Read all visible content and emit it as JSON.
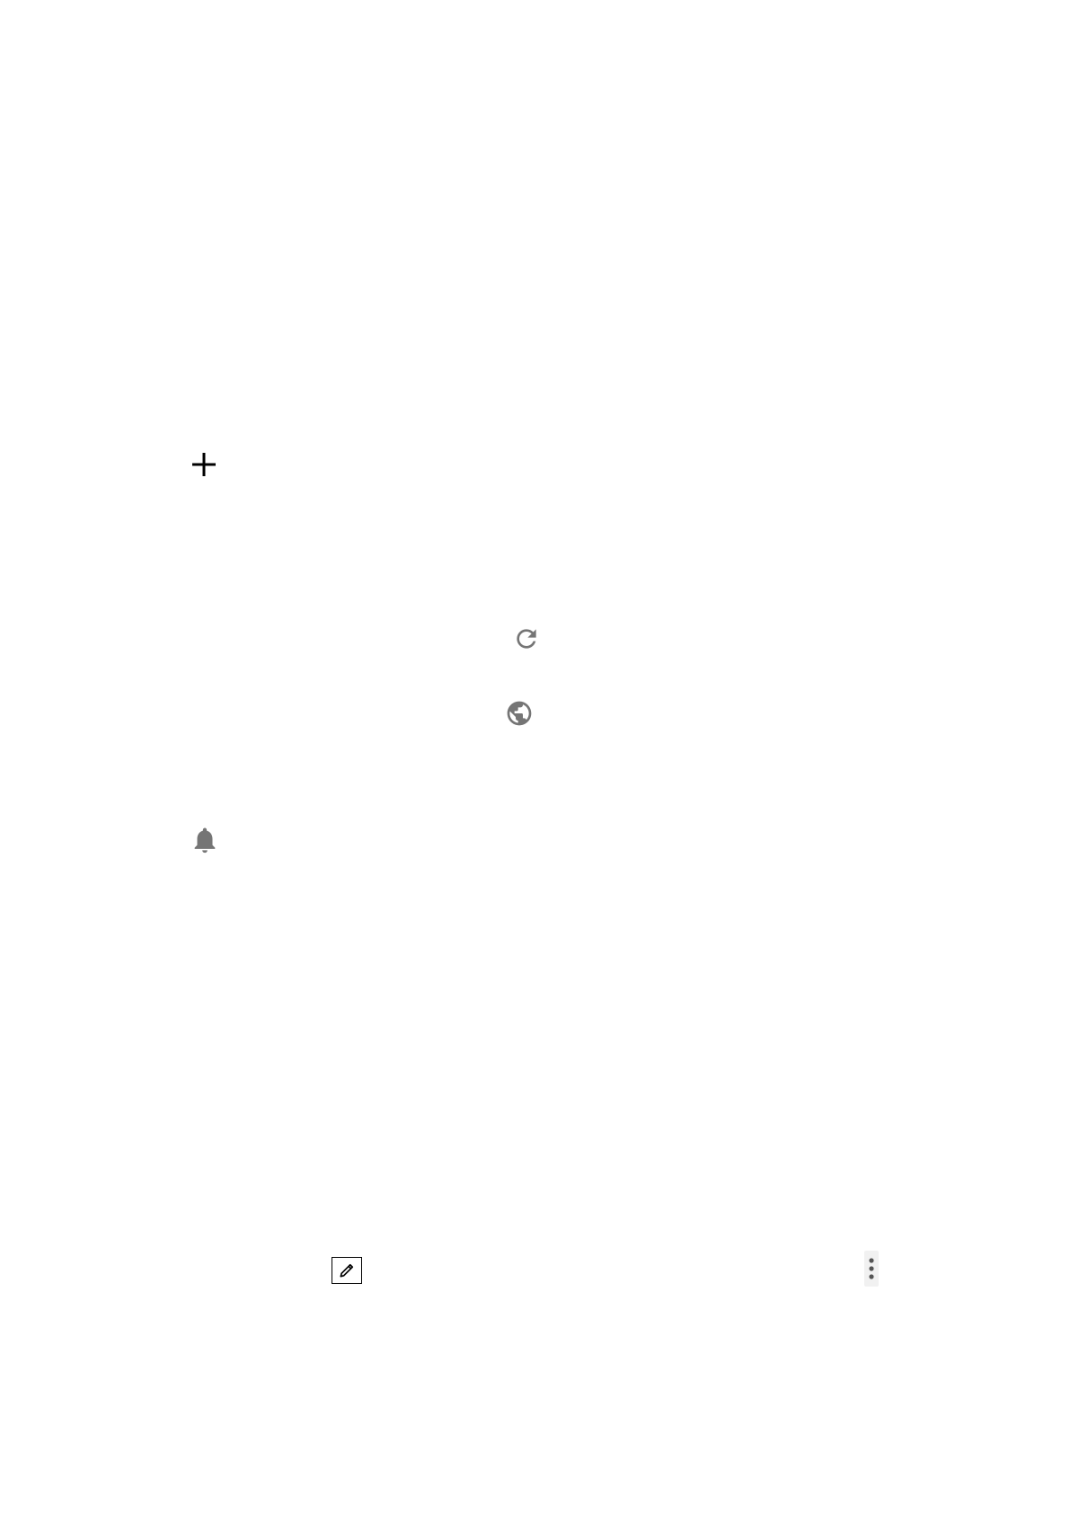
{
  "colors": {
    "background": "#ffffff",
    "icon_dark": "#000000",
    "icon_gray": "#757575"
  },
  "icons": {
    "add": "plus-icon",
    "refresh": "refresh-icon",
    "globe": "globe-icon",
    "notifications": "bell-icon",
    "edit": "pencil-icon",
    "more": "more-vertical-icon"
  }
}
